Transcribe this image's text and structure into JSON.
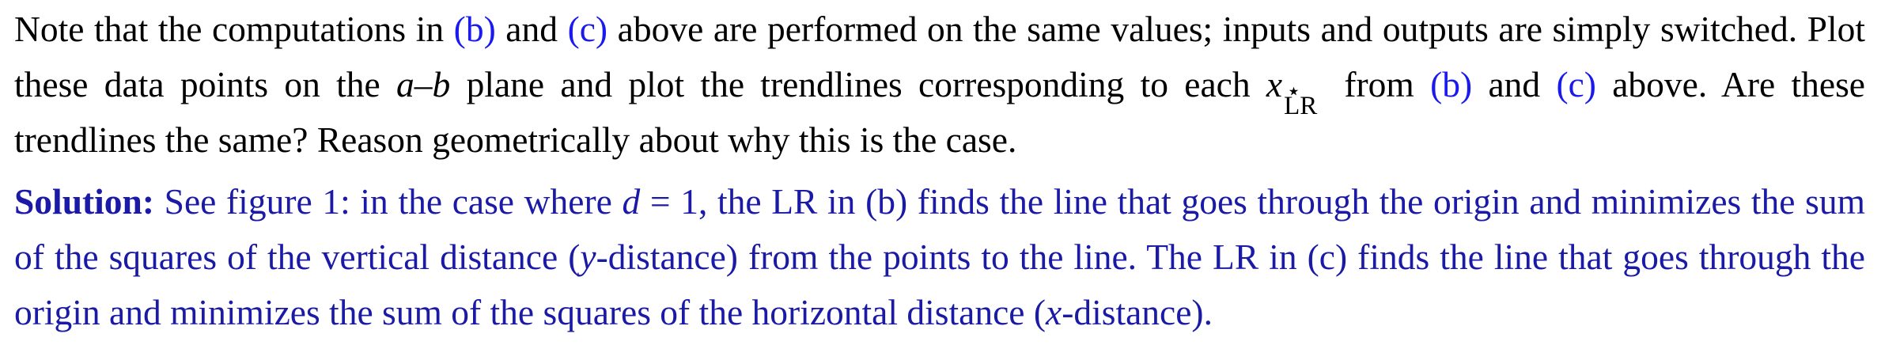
{
  "problem": {
    "t1": "Note that the computations in ",
    "ref_b": "(b)",
    "t2": " and ",
    "ref_c": "(c)",
    "t3": " above are performed on the same values; inputs and outputs are simply switched. Plot these data points on the ",
    "var_a": "a",
    "dash": "–",
    "var_b": "b",
    "t4": " plane and plot the trendlines corresponding to each ",
    "var_x": "x",
    "star": "⋆",
    "lr_sub": "LR",
    "t5": " from ",
    "ref_b2": "(b)",
    "t6": " and ",
    "ref_c2": "(c)",
    "t7": " above.  Are these trendlines the same? Reason geometrically about why this is the case."
  },
  "solution": {
    "label": "Solution:",
    "t1": " See figure ",
    "fig_ref": "1",
    "t2": ":  in the case where ",
    "var_d": "d",
    "eq": " = 1",
    "t3": ", the LR in (b) finds the line that goes through the origin and minimizes the sum of the squares of the vertical distance (",
    "var_y": "y",
    "t4": "-distance) from the points to the line.  The LR in (c) finds the line that goes through the origin and minimizes the sum of the squares of the horizontal distance (",
    "var_x": "x",
    "t5": "-distance)."
  }
}
